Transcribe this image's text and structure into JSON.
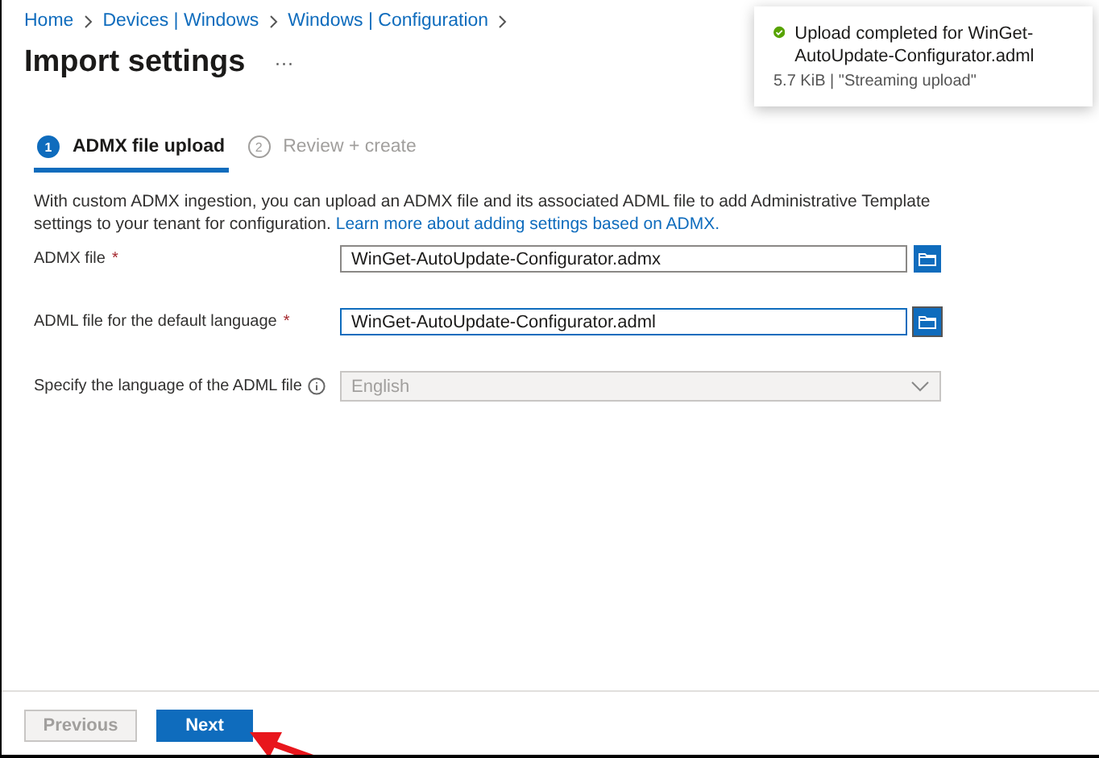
{
  "breadcrumb": [
    "Home",
    "Devices | Windows",
    "Windows | Configuration"
  ],
  "title": "Import settings",
  "more_menu": "···",
  "notification": {
    "title": "Upload completed for WinGet-AutoUpdate-Configurator.adml",
    "detail": "5.7 KiB | \"Streaming upload\""
  },
  "steps": [
    {
      "number": "1",
      "label": "ADMX file upload",
      "selected": true
    },
    {
      "number": "2",
      "label": "Review + create",
      "selected": false
    }
  ],
  "description": {
    "text": "With custom ADMX ingestion, you can upload an ADMX file and its associated ADML file to add Administrative Template settings to your tenant for configuration.",
    "link": "Learn more about adding settings based on ADMX."
  },
  "fields": [
    {
      "kind": "file",
      "label": "ADMX file",
      "required_mark": "*",
      "value": "WinGet-AutoUpdate-Configurator.admx",
      "focused": false,
      "disabled": false
    },
    {
      "kind": "file",
      "label": "ADML file for the default language",
      "required_mark": "*",
      "value": "WinGet-AutoUpdate-Configurator.adml",
      "focused": true,
      "disabled": false
    },
    {
      "kind": "dropdown",
      "label": "Specify the language of the ADML file",
      "info": true,
      "value": "English",
      "focused": false,
      "disabled": true
    }
  ],
  "buttons": [
    {
      "label": "Previous",
      "kind": "secondary",
      "disabled": true
    },
    {
      "label": "Next",
      "kind": "primary",
      "disabled": false
    }
  ],
  "annotation_arrow": true
}
